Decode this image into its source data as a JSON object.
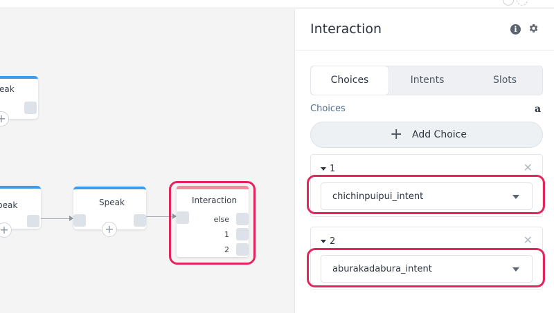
{
  "canvas": {
    "blocks": [
      {
        "title": "eak"
      },
      {
        "title": "peak"
      },
      {
        "title": "Speak"
      }
    ],
    "interaction": {
      "title": "Interaction",
      "paths": [
        "else",
        "1",
        "2"
      ]
    },
    "add_symbol": "+"
  },
  "panel": {
    "title": "Interaction",
    "info_symbol": "i",
    "tabs": [
      {
        "label": "Choices",
        "active": true
      },
      {
        "label": "Intents",
        "active": false
      },
      {
        "label": "Slots",
        "active": false
      }
    ],
    "section_label": "Choices",
    "amazon_symbol": "a",
    "add_choice_symbol": "+",
    "add_choice_label": "Add Choice",
    "close_symbol": "✕",
    "choices": [
      {
        "number": "1",
        "intent": "chichinpuipui_intent"
      },
      {
        "number": "2",
        "intent": "aburakadabura_intent"
      }
    ]
  },
  "colors": {
    "highlight": "#e4245c",
    "speak_header": "#3d9be9",
    "interaction_header": "#f38a9e"
  }
}
